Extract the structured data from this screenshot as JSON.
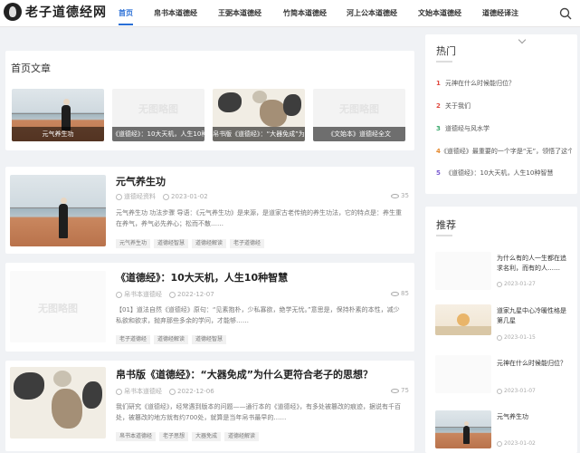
{
  "site": {
    "title": "老子道德经网"
  },
  "nav": {
    "items": [
      "首页",
      "帛书本道德经",
      "王弼本道德经",
      "竹简本道德经",
      "河上公本道德经",
      "文始本道德经",
      "道德经译注"
    ],
    "active_index": 0
  },
  "home": {
    "title": "首页文章",
    "featured": [
      {
        "caption": "元气养生功",
        "image": "photo-lake"
      },
      {
        "caption": "《道德经》：10大天机，人生10种智慧",
        "image": "no-image",
        "placeholder": "无图略图"
      },
      {
        "caption": "帛书版《道德经》：“大器免成”为什么更符合老子的思想？",
        "image": "photo-ink"
      },
      {
        "caption": "《文始本》道德经全文",
        "image": "no-image",
        "placeholder": "无图略图"
      }
    ]
  },
  "posts": [
    {
      "title": "元气养生功",
      "category": "道德经资料",
      "date": "2023-01-02",
      "views": "35",
      "excerpt": "元气养生功 功法步骤 导语：《元气养生功》是来源，是道家古老传统的养生功法，它的特点是：养生重在养气，养气必先养心；松而不散……",
      "tags": [
        "元气养生功",
        "道德经智慧",
        "道德经解读",
        "老子道德经"
      ],
      "image": "photo-lake"
    },
    {
      "title": "《道德经》：10大天机，人生10种智慧",
      "category": "帛书本道德经",
      "date": "2022-12-07",
      "views": "85",
      "excerpt": "【01】道法自然《道德经》原句：“见素抱朴，少私寡欲，绝学无忧。”意思是，保持朴素的本性，减少私欲和欲求，抛弃那些多余的学问，才能够……",
      "tags": [
        "老子道德经",
        "道德经解读",
        "道德经智慧"
      ],
      "image": "no-image",
      "placeholder": "无图略图"
    },
    {
      "title": "帛书版《道德经》：“大器免成”为什么更符合老子的思想？",
      "category": "帛书本道德经",
      "date": "2022-12-06",
      "views": "75",
      "excerpt": "我们研究《道德经》，经常遇到版本的问题——通行本的《道德经》，有多处被篡改的痕迹，据说有千百处，被篡改的地方就有约700处，就算是当年帛书最早的……",
      "tags": [
        "帛书本道德经",
        "老子思想",
        "大器免成",
        "道德经解读"
      ],
      "image": "photo-ink"
    }
  ],
  "sidebar": {
    "hot": {
      "title": "热门",
      "items": [
        {
          "num": "1",
          "text": "元神在什么时候能归位？",
          "color": "#e0483e"
        },
        {
          "num": "2",
          "text": "关于我们",
          "color": "#e0483e"
        },
        {
          "num": "3",
          "text": "道德经与风水学",
          "color": "#3aa86b"
        },
        {
          "num": "4",
          "text": "《道德经》最重要的一个字是“无”，领悟了这个字...",
          "color": "#e58a2f"
        },
        {
          "num": "5",
          "text": "《道德经》：10大天机，人生10种智慧",
          "color": "#7a5bd1"
        }
      ]
    },
    "recommend": {
      "title": "推荐",
      "items": [
        {
          "title": "为什么有的人一生都在追求名利，而有的人……",
          "date": "2023-01-27",
          "image": "no-image"
        },
        {
          "title": "道家九星中心冷暖性格是第几星",
          "date": "2023-01-15",
          "image": "photo-sun"
        },
        {
          "title": "元神在什么时候能归位？",
          "date": "2023-01-07",
          "image": "no-image"
        },
        {
          "title": "元气养生功",
          "date": "2023-01-02",
          "image": "photo-lake"
        }
      ]
    }
  }
}
